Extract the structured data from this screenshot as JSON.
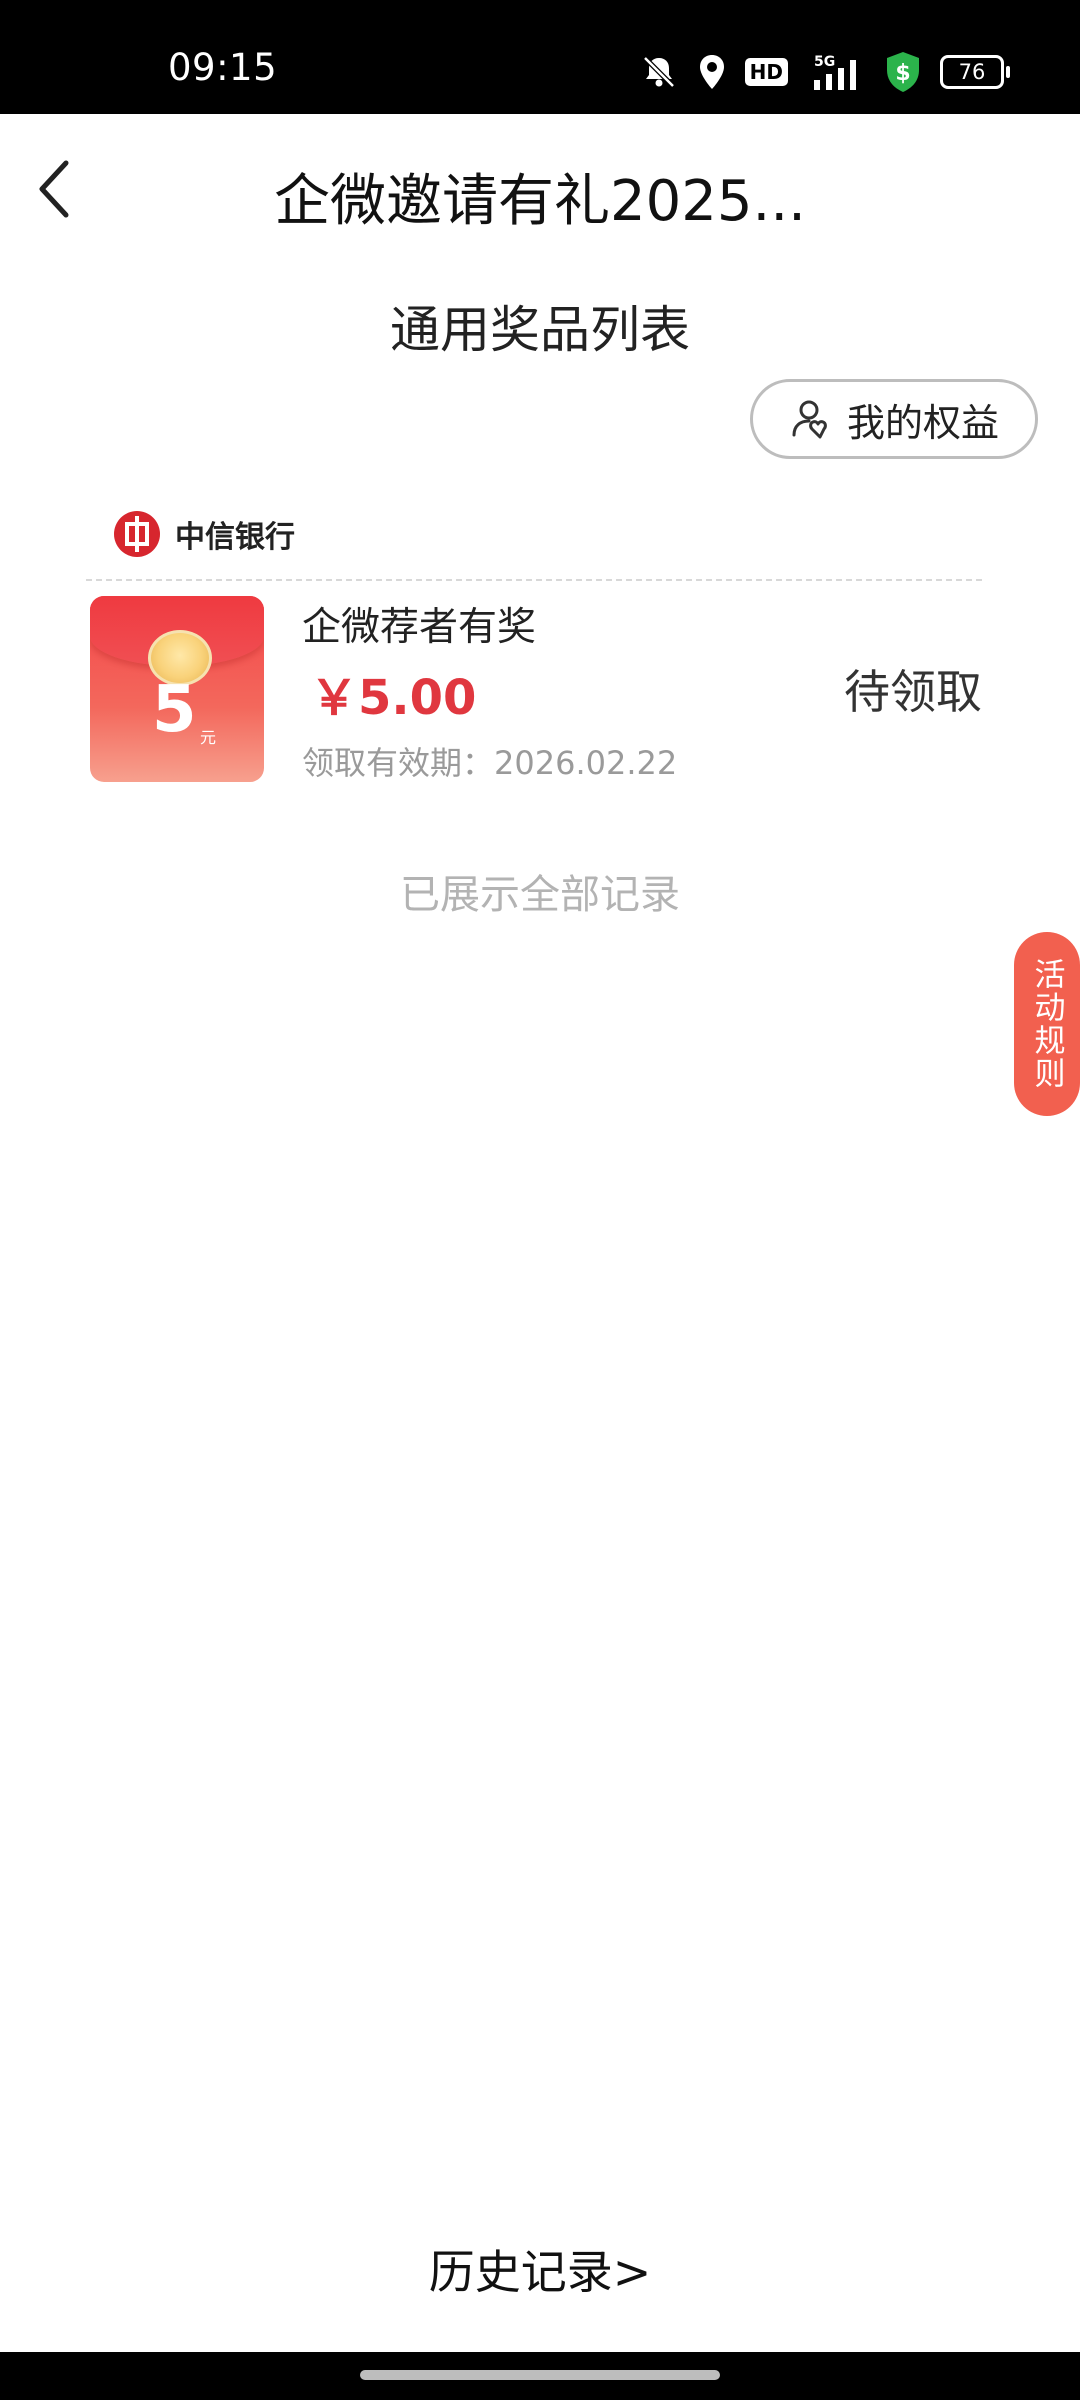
{
  "status_bar": {
    "time": "09:15",
    "icons": [
      "bell-off-icon",
      "location-icon",
      "hd-icon",
      "signal-5g-icon",
      "security-shield-icon",
      "battery-icon"
    ],
    "hd_label": "HD",
    "network_label": "5G",
    "battery_level": "76",
    "shield_color": "#2bb34b"
  },
  "header": {
    "title": "企微邀请有礼2025...",
    "back_icon": "chevron-left-icon"
  },
  "section_title": "通用奖品列表",
  "benefits_button": {
    "label": "我的权益",
    "icon": "user-heart-icon"
  },
  "bank": {
    "name": "中信银行",
    "logo_color": "#d7262e"
  },
  "prizes": [
    {
      "name": "企微荐者有奖",
      "price": "￥5.00",
      "expiry": "领取有效期：2026.02.22",
      "status": "待领取",
      "image": {
        "amount": "5",
        "unit": "元"
      }
    }
  ],
  "end_note": "已展示全部记录",
  "rules_tab": {
    "label": "活动规则",
    "color": "#f2604f"
  },
  "history_link": "历史记录>",
  "colors": {
    "price": "#e0373f",
    "accent_red": "#f2604f"
  }
}
